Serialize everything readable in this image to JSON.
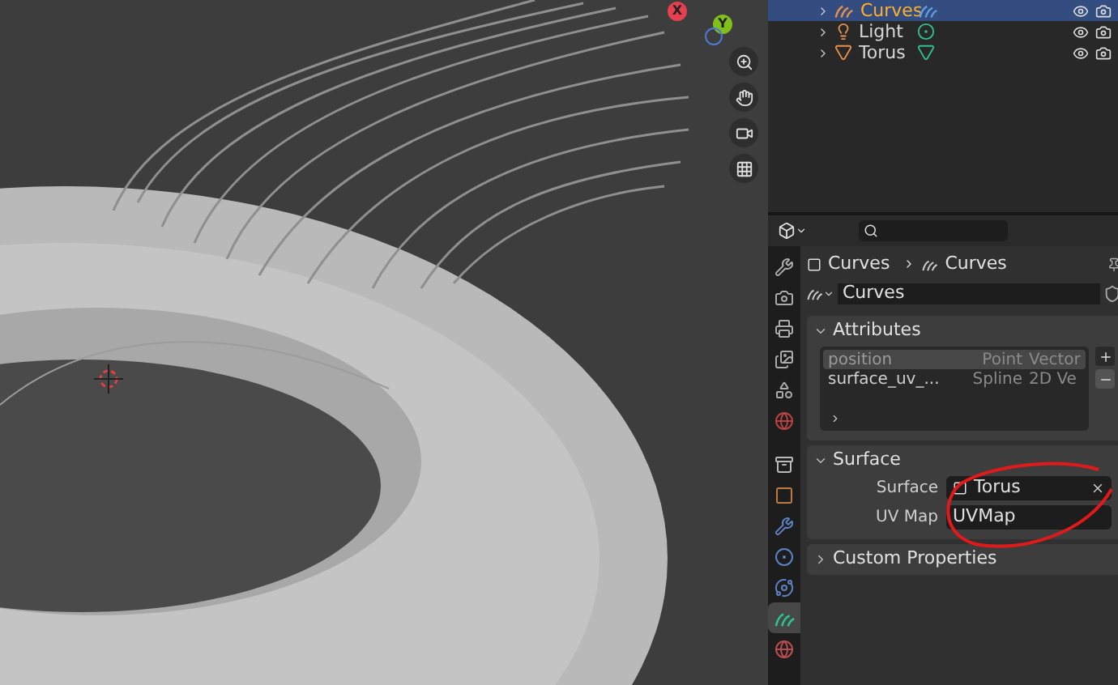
{
  "viewport": {
    "axes": [
      {
        "label": "X",
        "color": "#e5404f"
      },
      {
        "label": "Y",
        "color": "#81c01a"
      }
    ]
  },
  "outliner": {
    "rows": [
      {
        "name": "Curves",
        "kind": "curves",
        "selected": true
      },
      {
        "name": "Light",
        "kind": "light",
        "selected": false
      },
      {
        "name": "Torus",
        "kind": "mesh",
        "selected": false
      }
    ]
  },
  "properties": {
    "tabs": [
      {
        "kind": "tool",
        "selected": false
      },
      {
        "kind": "render",
        "selected": false
      },
      {
        "kind": "output",
        "selected": false
      },
      {
        "kind": "view_layer",
        "selected": false
      },
      {
        "kind": "scene",
        "selected": false
      },
      {
        "kind": "world",
        "selected": false
      },
      {
        "kind": "collection",
        "selected": false
      },
      {
        "kind": "object",
        "selected": false
      },
      {
        "kind": "modifier",
        "selected": false
      },
      {
        "kind": "particles",
        "selected": false
      },
      {
        "kind": "physics",
        "selected": false
      },
      {
        "kind": "data",
        "selected": true
      },
      {
        "kind": "material",
        "selected": false
      }
    ],
    "breadcrumb": [
      "Curves",
      "Curves"
    ],
    "datablock": "Curves",
    "panels": [
      {
        "kind": "list",
        "title": "Attributes",
        "expanded": true,
        "rows": [
          {
            "cells": [
              "position",
              "Point",
              "Vector"
            ],
            "selected": true
          },
          {
            "cells": [
              "surface_uv_...",
              "Spline",
              "2D Ve"
            ],
            "selected": false
          }
        ]
      },
      {
        "kind": "fields",
        "title": "Surface",
        "expanded": true,
        "fields": [
          {
            "label": "Surface",
            "value": "Torus",
            "kind": "object"
          },
          {
            "label": "UV Map",
            "value": "UVMap",
            "kind": "text"
          }
        ]
      },
      {
        "kind": "fields",
        "title": "Custom Properties",
        "expanded": false
      }
    ]
  }
}
